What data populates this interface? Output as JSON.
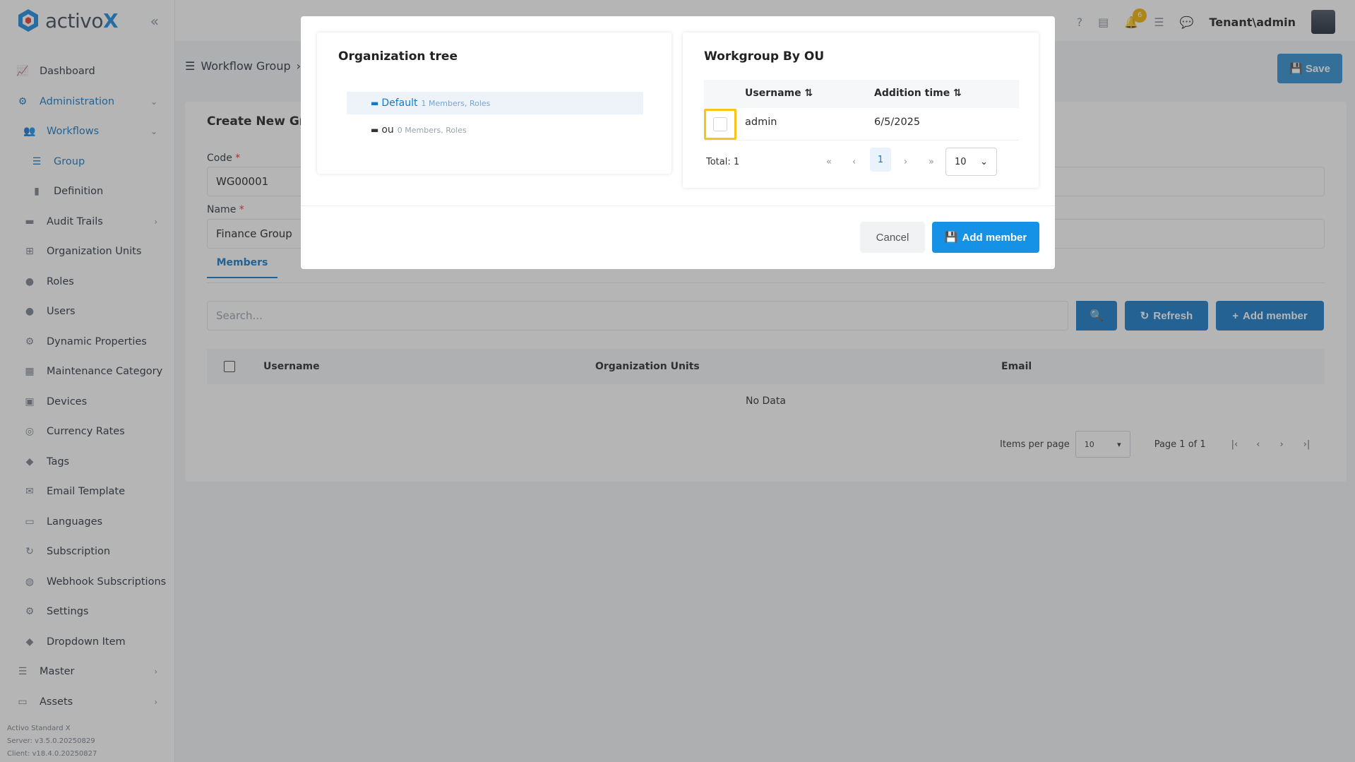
{
  "brand": {
    "name_prefix": "activo",
    "name_suffix": "X"
  },
  "topbar": {
    "user": "Tenant\\admin",
    "notifications": "6"
  },
  "sidebar": {
    "items": [
      {
        "label": "Dashboard",
        "icon": "chart-icon"
      },
      {
        "label": "Administration",
        "icon": "cogs-icon"
      },
      {
        "label": "Workflows",
        "icon": "users-icon"
      },
      {
        "label": "Group",
        "icon": "list-icon"
      },
      {
        "label": "Definition",
        "icon": "clipboard-icon"
      },
      {
        "label": "Audit Trails",
        "icon": "folder-icon"
      },
      {
        "label": "Organization Units",
        "icon": "sitemap-icon"
      },
      {
        "label": "Roles",
        "icon": "user-tag-icon"
      },
      {
        "label": "Users",
        "icon": "users-icon"
      },
      {
        "label": "Dynamic Properties",
        "icon": "gear-icon"
      },
      {
        "label": "Maintenance Category",
        "icon": "grid-icon"
      },
      {
        "label": "Devices",
        "icon": "printer-icon"
      },
      {
        "label": "Currency Rates",
        "icon": "coins-icon"
      },
      {
        "label": "Tags",
        "icon": "tags-icon"
      },
      {
        "label": "Email Template",
        "icon": "envelope-icon"
      },
      {
        "label": "Languages",
        "icon": "language-icon"
      },
      {
        "label": "Subscription",
        "icon": "sync-icon"
      },
      {
        "label": "Webhook Subscriptions",
        "icon": "globe-icon"
      },
      {
        "label": "Settings",
        "icon": "gear-icon"
      },
      {
        "label": "Dropdown Item",
        "icon": "tags-icon"
      },
      {
        "label": "Master",
        "icon": "database-icon"
      },
      {
        "label": "Assets",
        "icon": "laptop-icon"
      }
    ],
    "version": {
      "product": "Activo Standard X",
      "server": "Server: v3.5.0.20250829",
      "client": "Client: v18.4.0.20250827"
    }
  },
  "page": {
    "breadcrumb": "Workflow Group",
    "save_label": "Save",
    "card_title": "Create New Group",
    "code_label": "Code",
    "code_value": "WG00001",
    "name_label": "Name",
    "name_value": "Finance Group",
    "tab_members": "Members",
    "search_placeholder": "Search...",
    "refresh_label": "Refresh",
    "add_member_label": "Add member",
    "columns": [
      "Username",
      "Organization Units",
      "Email"
    ],
    "no_data": "No Data",
    "items_per_page_label": "Items per page",
    "items_per_page_value": "10",
    "page_info": "Page 1 of 1"
  },
  "modal": {
    "tree_title": "Organization tree",
    "tree_nodes": [
      {
        "name": "Default",
        "meta": "1 Members, Roles"
      },
      {
        "name": "ou",
        "meta": "0 Members, Roles"
      }
    ],
    "wg_title": "Workgroup By OU",
    "wg_columns": [
      "Username",
      "Addition time"
    ],
    "wg_rows": [
      {
        "username": "admin",
        "added": "6/5/2025"
      }
    ],
    "total": "Total: 1",
    "current_page": "1",
    "page_size": "10",
    "cancel_label": "Cancel",
    "add_label": "Add member"
  },
  "colors": {
    "primary": "#1479c7",
    "accent": "#1592e6",
    "highlight": "#f5c518"
  }
}
